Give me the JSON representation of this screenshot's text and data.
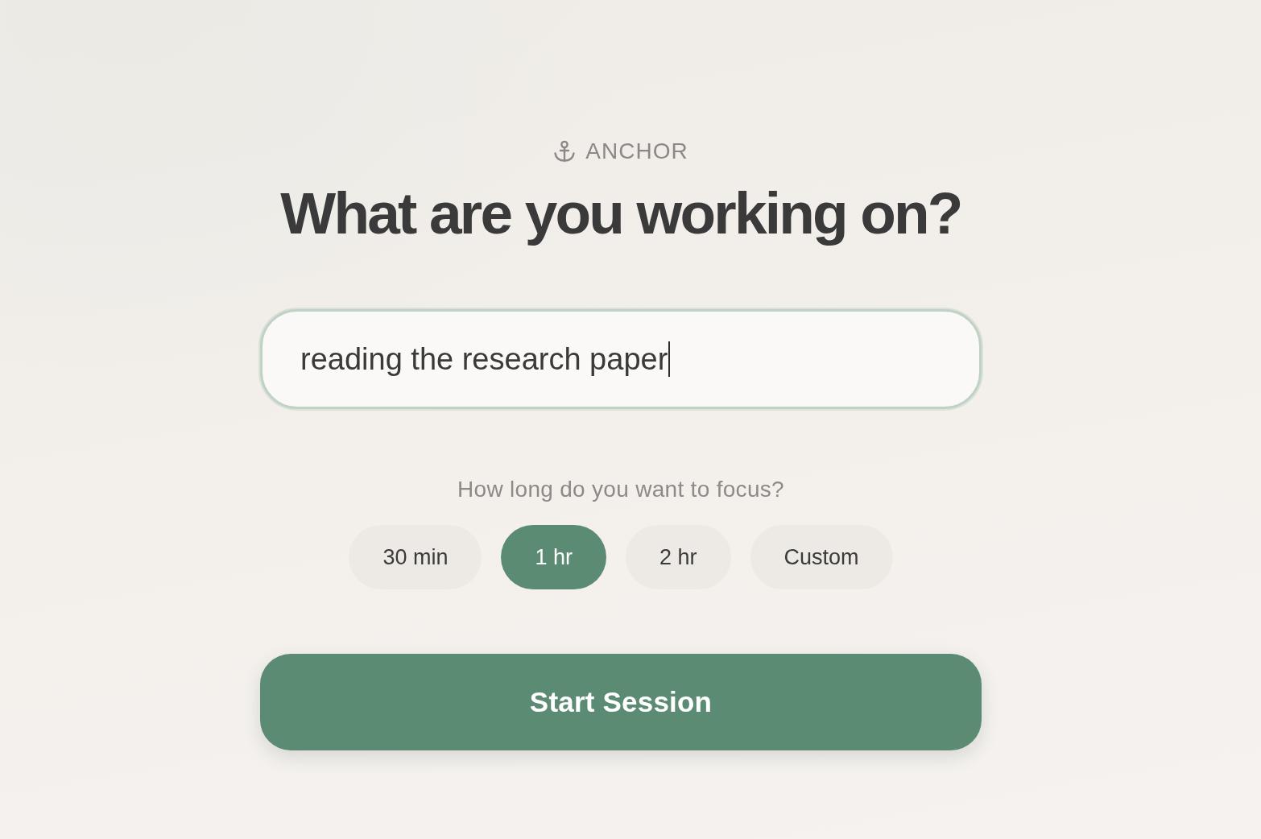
{
  "brand": {
    "name": "ANCHOR"
  },
  "heading": "What are you working on?",
  "task_input": {
    "value": "reading the research paper",
    "focused": true
  },
  "duration": {
    "prompt": "How long do you want to focus?",
    "options": [
      {
        "label": "30 min",
        "selected": false
      },
      {
        "label": "1 hr",
        "selected": true
      },
      {
        "label": "2 hr",
        "selected": false
      },
      {
        "label": "Custom",
        "selected": false
      }
    ]
  },
  "start_button": {
    "label": "Start Session"
  }
}
